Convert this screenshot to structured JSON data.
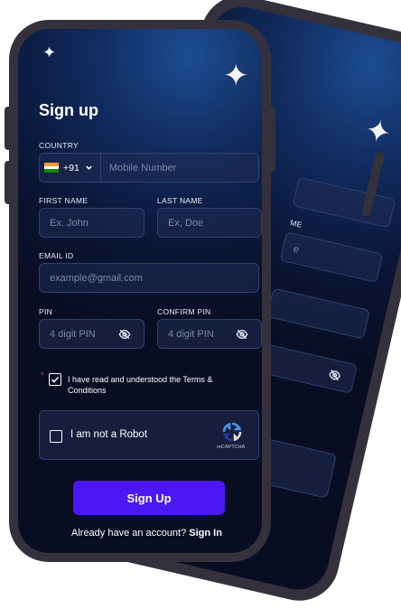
{
  "form": {
    "title": "Sign up",
    "country_label": "COUNTRY",
    "country_code": "+91",
    "mobile_placeholder": "Mobile Number",
    "first_name_label": "FIRST NAME",
    "first_name_placeholder": "Ex. John",
    "last_name_label": "LAST NAME",
    "last_name_placeholder": "Ex, Doe",
    "email_label": "EMAIL ID",
    "email_placeholder": "example@gmail.com",
    "pin_label": "PIN",
    "pin_placeholder": "4 digit PIN",
    "confirm_pin_label": "CONFIRM PIN",
    "confirm_pin_placeholder": "4 digit PIN",
    "required_mark": "*",
    "terms_text": "I have read and understood the Terms & Conditions",
    "robot_text": "I am not a Robot",
    "recaptcha_label": "reCAPTCHA",
    "signup_button": "Sign Up",
    "footer_prompt": "Already have an account?",
    "footer_link": "Sign In"
  },
  "back_screen": {
    "partial_label": "ME",
    "partial_placeholder": "e"
  },
  "colors": {
    "accent": "#4b17f5",
    "required": "#e23b4e",
    "phone_frame": "#34313d"
  },
  "icons": [
    "sparkle-icon",
    "india-flag-icon",
    "chevron-down-icon",
    "eye-off-icon",
    "check-icon",
    "recaptcha-icon"
  ]
}
